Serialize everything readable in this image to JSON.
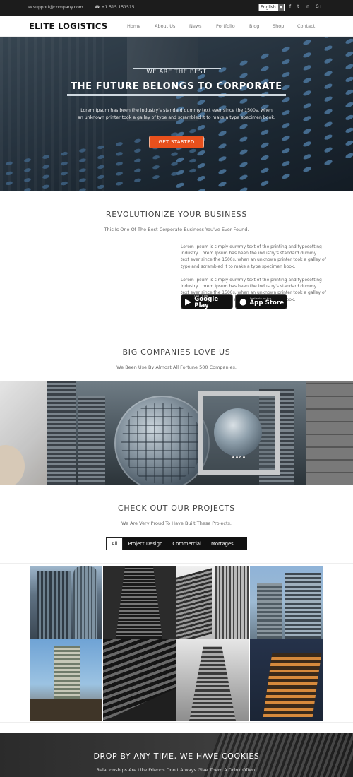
{
  "topbar": {
    "email": "support@company.com",
    "phone": "+1 515 151515",
    "language": "English",
    "social_icons": [
      "facebook-icon",
      "twitter-icon",
      "linkedin-icon",
      "google-plus-icon"
    ]
  },
  "navbar": {
    "logo": "ELITE LOGISTICS",
    "items": [
      "Home",
      "About Us",
      "News",
      "Portfolio",
      "Blog",
      "Shop",
      "Contact"
    ]
  },
  "hero": {
    "subtitle": "WE ARE THE BEST",
    "title": "THE FUTURE BELONGS TO CORPORATE",
    "description": "Lorem Ipsum has been the industry's standard dummy text ever since the 1500s, when an unknown printer took a galley of type and scrambled it to make a type specimen book.",
    "button": "GET STARTED"
  },
  "revolutionize": {
    "title": "REVOLUTIONIZE YOUR BUSINESS",
    "subtitle": "This Is One Of The Best Corporate Business You've Ever Found.",
    "paragraphs": [
      "Lorem Ipsum is simply dummy text of the printing and typesetting industry. Lorem Ipsum has been the industry's standard dummy text ever since the 1500s, when an unknown printer took a galley of type and scrambled it to make a type specimen book.",
      "Lorem Ipsum is simply dummy text of the printing and typesetting industry. Lorem Ipsum has been the industry's standard dummy text ever since the 1500s, when an unknown printer took a galley of type and scrambled it to make a type specimen book."
    ],
    "google_play": {
      "small": "GET IT ON",
      "big": "Google Play"
    },
    "app_store": {
      "small": "Available on the",
      "big": "App Store"
    }
  },
  "companies": {
    "title": "BIG COMPANIES LOVE US",
    "subtitle": "We Been Use By Almost All Fortune 500 Companies."
  },
  "projects": {
    "title": "CHECK OUT OUR PROJECTS",
    "subtitle": "We Are Very Proud To Have Built These Projects.",
    "filters": [
      "All",
      "Project Design",
      "Commercial",
      "Mortages"
    ],
    "active_filter": "All"
  },
  "cta": {
    "title": "DROP BY ANY TIME, WE HAVE COOKIES",
    "subtitle": "Relationships Are Like Friends Don't Always Give Them A Drink Often."
  },
  "colors": {
    "accent": "#e8501c",
    "topbar": "#1c1c1c"
  }
}
